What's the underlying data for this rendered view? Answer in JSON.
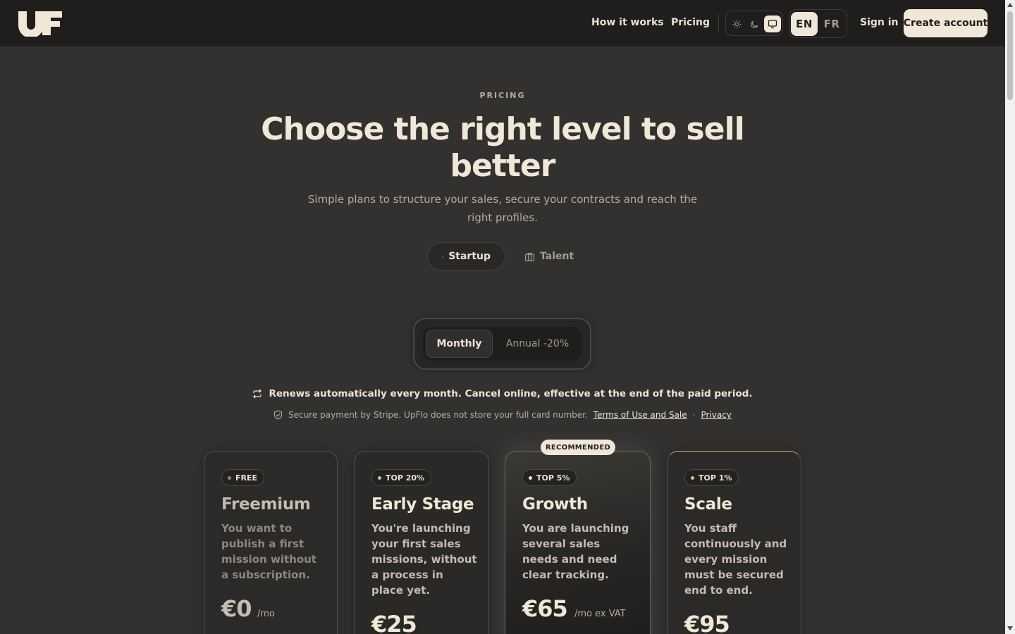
{
  "header": {
    "logo_text": "UF",
    "nav": [
      "How it works",
      "Pricing"
    ],
    "theme_options": [
      "light",
      "dark",
      "system"
    ],
    "theme_selected": "system",
    "languages": [
      "EN",
      "FR"
    ],
    "language_selected": "EN",
    "sign_in": "Sign in",
    "create_account": "Create account"
  },
  "hero": {
    "eyebrow": "PRICING",
    "title": "Choose the right level to sell better",
    "subtitle": "Simple plans to structure your sales, secure your contracts and reach the right profiles."
  },
  "audience": {
    "options": [
      "Startup",
      "Talent"
    ],
    "selected": "Startup"
  },
  "billing": {
    "options": [
      "Monthly",
      "Annual -20%"
    ],
    "selected": "Monthly"
  },
  "notes": {
    "renew": "Renews automatically every month. Cancel online, effective at the end of the paid period.",
    "secure": "Secure payment by Stripe. UpFlo does not store your full card number.",
    "terms_link": "Terms of Use and Sale",
    "separator": "·",
    "privacy_link": "Privacy"
  },
  "recommended_label": "RECOMMENDED",
  "plans": [
    {
      "badge": "FREE",
      "name": "Freemium",
      "description": "You want to publish a first mission without a subscription.",
      "price": "€0",
      "unit": "/mo",
      "dot_color": "#8e887f"
    },
    {
      "badge": "TOP 20%",
      "name": "Early Stage",
      "description": "You're launching your first sales missions, without a process in place yet.",
      "price": "€25",
      "unit": "",
      "dot_color": "#c4bcb0"
    },
    {
      "badge": "TOP 5%",
      "name": "Growth",
      "description": "You are launching several sales needs and need clear tracking.",
      "price": "€65",
      "unit": "/mo ex VAT",
      "dot_color": "#f1e7d6"
    },
    {
      "badge": "TOP 1%",
      "name": "Scale",
      "description": "You staff continuously and every mission must be secured end to end.",
      "price": "€95",
      "unit": "",
      "dot_color": "#e0c07a"
    }
  ]
}
